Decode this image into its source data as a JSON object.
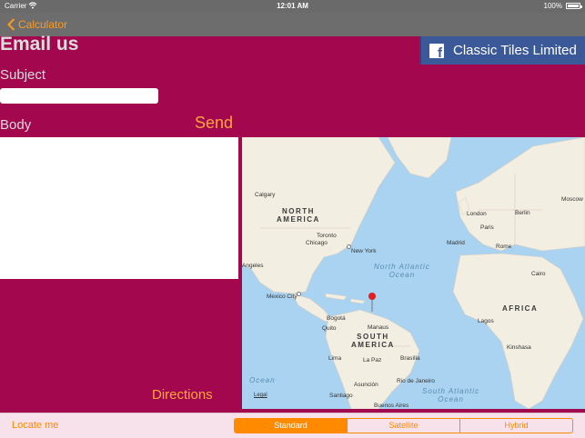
{
  "status_bar": {
    "carrier": "Carrier",
    "time": "12:01 AM",
    "battery": "100%"
  },
  "nav": {
    "back_label": "Calculator"
  },
  "facebook": {
    "label": "Classic Tiles Limited"
  },
  "form": {
    "title": "Email us",
    "subject_label": "Subject",
    "subject_value": "",
    "body_label": "Body",
    "body_value": "",
    "send_label": "Send",
    "directions_label": "Directions"
  },
  "map": {
    "regions": {
      "north_america": "NORTH\nAMERICA",
      "south_america": "SOUTH\nAMERICA",
      "africa": "AFRICA"
    },
    "oceans": {
      "north_atlantic": "North Atlantic\nOcean",
      "south_atlantic": "South Atlantic\nOcean",
      "pacific": "Ocean"
    },
    "cities": {
      "calgary": "Calgary",
      "toronto": "Toronto",
      "chicago": "Chicago",
      "new_york": "New York",
      "angeles": "Angeles",
      "mexico_city": "Mexico City",
      "bogota": "Bogotá",
      "quito": "Quito",
      "manaus": "Manaus",
      "lima": "Lima",
      "la_paz": "La Paz",
      "brasilia": "Brasília",
      "rio": "Rio de Janeiro",
      "asuncion": "Asunción",
      "santiago": "Santiago",
      "buenos_aires": "Buenos Aires",
      "london": "London",
      "paris": "Paris",
      "madrid": "Madrid",
      "berlin": "Berlin",
      "rome": "Rome",
      "moscow": "Moscow",
      "cairo": "Cairo",
      "lagos": "Lagos",
      "kinshasa": "Kinshasa"
    },
    "legal": "Legal",
    "colors": {
      "water": "#a9d3f0",
      "land": "#f3eee2",
      "pin": "#e0201e"
    }
  },
  "toolbar": {
    "locate_label": "Locate me",
    "segments": [
      "Standard",
      "Satellite",
      "Hybrid"
    ],
    "selected": "Standard"
  },
  "colors": {
    "background": "#a3084f",
    "accent": "#ff8a00",
    "facebook": "#3b5998"
  }
}
